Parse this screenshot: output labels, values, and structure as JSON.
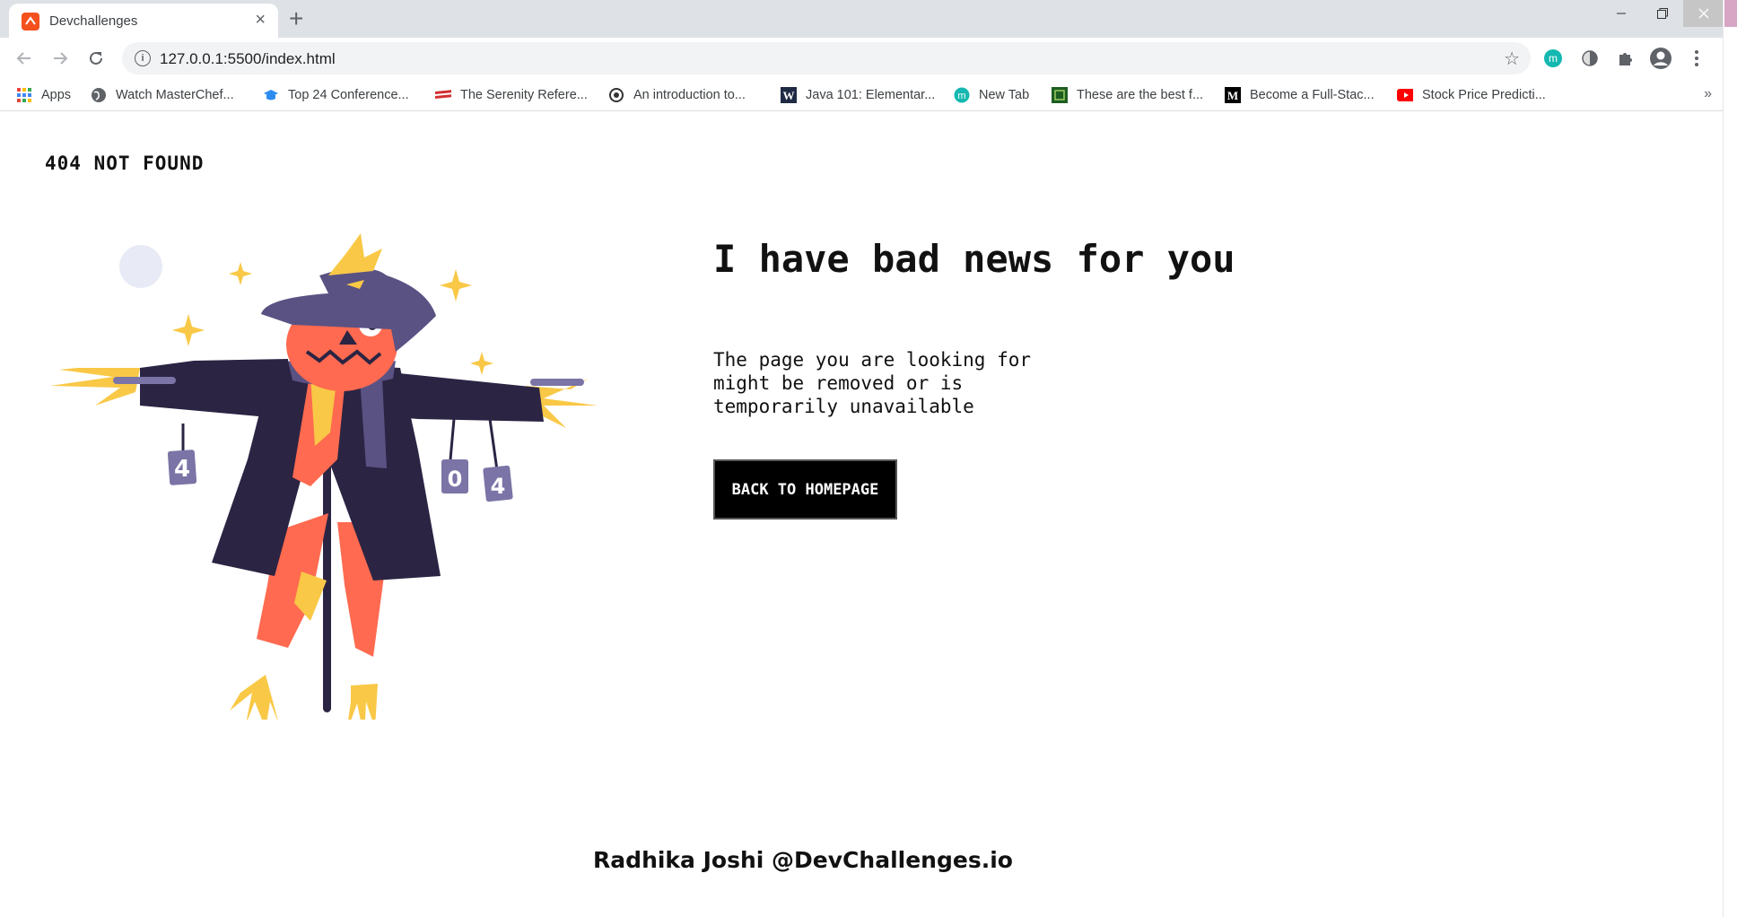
{
  "browser": {
    "tab_title": "Devchallenges",
    "url": "127.0.0.1:5500/index.html",
    "tab_close": "×",
    "new_tab": "+",
    "bookmarks": [
      {
        "label": "Apps",
        "icon": "apps-grid-icon"
      },
      {
        "label": "Watch MasterChef...",
        "icon": "globe-icon"
      },
      {
        "label": "Top 24 Conference...",
        "icon": "graduation-cap-icon"
      },
      {
        "label": "The Serenity Refere...",
        "icon": "serenity-icon"
      },
      {
        "label": "An introduction to...",
        "icon": "refresh-circle-icon"
      },
      {
        "label": "Java 101: Elementar...",
        "icon": "w-logo-icon"
      },
      {
        "label": "New Tab",
        "icon": "m-circle-icon"
      },
      {
        "label": "These are the best f...",
        "icon": "green-box-icon"
      },
      {
        "label": "Become a Full-Stac...",
        "icon": "medium-m-icon"
      },
      {
        "label": "Stock Price Predicti...",
        "icon": "youtube-icon"
      }
    ],
    "bookmarks_more": "»",
    "colors": {
      "tab_strip": "#dee1e6",
      "favicon": "#f4511e"
    }
  },
  "page": {
    "brand": "404 NOT FOUND",
    "headline": "I have bad news for you",
    "description": "The page you are looking for might be removed or is temporarily unavailable",
    "button_label": "BACK TO HOMEPAGE",
    "footer": "Radhika Joshi @DevChallenges.io",
    "illustration": {
      "can_digits": [
        "4",
        "0",
        "4"
      ],
      "colors": {
        "coat": "#2b2443",
        "face": "#ff6a50",
        "hat": "#5a5283",
        "straw": "#f9c846",
        "moon": "#e8ebf5",
        "can": "#7b74a6"
      }
    }
  }
}
